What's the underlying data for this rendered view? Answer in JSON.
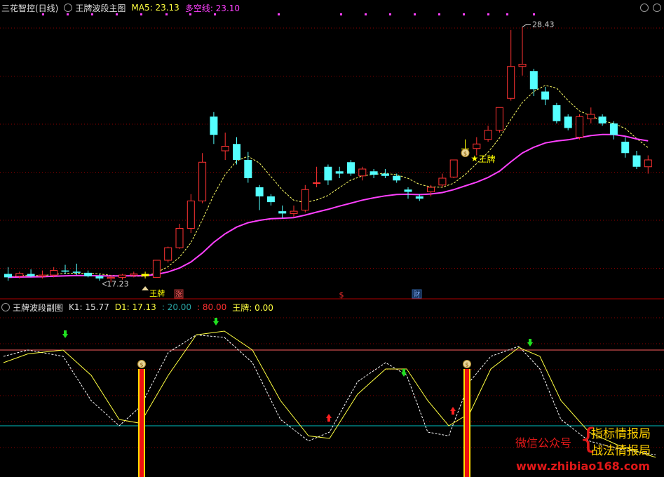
{
  "main_header": {
    "app_title": "三花智控(日线)",
    "indicator_name": "王牌波段主图",
    "ma5_label": "MA5: 23.13",
    "duokong_label": "多空线: 23.10"
  },
  "sub_header": {
    "indicator_name": "王牌波段副图",
    "k1_label": "K1: 15.77",
    "d1_label": "D1: 17.13",
    "level_low": ": 20.00",
    "level_high": ": 80.00",
    "wangpai_label": "王牌: 0.00"
  },
  "annotations": {
    "high_price": "28.43",
    "low_price": "17.23",
    "wangpai_text": "王牌",
    "wangpai_text_partial": "王牌",
    "zhang_badge": "涨",
    "cai_badge": "财",
    "dollar_mark": "$"
  },
  "watermark": {
    "wechat": "微信公众号",
    "line1": "指标情报局",
    "line2": "战法情报局",
    "url": "www.zhibiao168.com"
  },
  "colors": {
    "up_candle": "#ff3232",
    "down_candle": "#54ffff",
    "signal_bar": "#ffff00",
    "ma_line": "#ffff66",
    "duokong_line": "#ff40ff",
    "k_line": "#ffff40",
    "d_line": "#ffffff",
    "grid": "#8b0000",
    "level_80": "#ff6060",
    "level_20": "#00c0c0"
  },
  "chart_data": [
    {
      "type": "candlestick",
      "title": "王牌波段主图",
      "series": [
        {
          "name": "K线",
          "ohlc": [
            [
              17.6,
              17.9,
              17.3,
              17.45
            ],
            [
              17.5,
              17.7,
              17.4,
              17.62
            ],
            [
              17.6,
              17.8,
              17.45,
              17.5
            ],
            [
              17.5,
              17.75,
              17.4,
              17.55
            ],
            [
              17.55,
              17.9,
              17.45,
              17.75
            ],
            [
              17.75,
              18.0,
              17.6,
              17.7
            ],
            [
              17.7,
              18.05,
              17.55,
              17.65
            ],
            [
              17.65,
              17.75,
              17.45,
              17.5
            ],
            [
              17.5,
              17.6,
              17.3,
              17.4
            ],
            [
              17.4,
              17.55,
              17.23,
              17.45
            ],
            [
              17.45,
              17.6,
              17.35,
              17.55
            ],
            [
              17.55,
              17.7,
              17.45,
              17.6
            ],
            [
              17.6,
              17.7,
              17.4,
              17.5
            ],
            [
              17.45,
              18.2,
              17.45,
              18.2
            ],
            [
              18.2,
              18.8,
              18.1,
              18.75
            ],
            [
              18.75,
              19.8,
              18.7,
              19.6
            ],
            [
              19.6,
              21.1,
              19.4,
              20.8
            ],
            [
              20.8,
              22.9,
              20.7,
              22.5
            ],
            [
              24.5,
              24.7,
              23.3,
              23.7
            ],
            [
              23.0,
              23.8,
              22.6,
              23.2
            ],
            [
              23.3,
              23.6,
              22.4,
              22.6
            ],
            [
              22.6,
              22.95,
              21.6,
              21.8
            ],
            [
              21.4,
              21.5,
              20.4,
              21.0
            ],
            [
              21.0,
              21.1,
              20.6,
              20.75
            ],
            [
              20.35,
              20.6,
              20.05,
              20.25
            ],
            [
              20.25,
              20.6,
              20.1,
              20.35
            ],
            [
              20.4,
              21.5,
              20.3,
              21.3
            ],
            [
              21.6,
              22.3,
              21.4,
              21.6
            ],
            [
              22.3,
              22.4,
              21.5,
              21.7
            ],
            [
              22.1,
              22.3,
              21.8,
              22.0
            ],
            [
              22.5,
              22.6,
              21.9,
              22.0
            ],
            [
              21.9,
              22.3,
              21.7,
              22.2
            ],
            [
              22.1,
              22.2,
              21.8,
              21.95
            ],
            [
              22.0,
              22.2,
              21.8,
              21.9
            ],
            [
              21.9,
              22.0,
              21.6,
              21.7
            ],
            [
              21.3,
              21.4,
              20.9,
              21.2
            ],
            [
              21.0,
              21.1,
              20.8,
              20.9
            ],
            [
              21.2,
              21.5,
              21.0,
              21.4
            ],
            [
              21.5,
              22.0,
              21.4,
              21.8
            ],
            [
              21.85,
              22.6,
              21.8,
              22.6
            ],
            [
              23.1,
              23.5,
              22.9,
              23.1
            ],
            [
              23.1,
              23.6,
              22.8,
              23.3
            ],
            [
              23.5,
              24.1,
              23.4,
              23.9
            ],
            [
              23.9,
              24.5,
              23.8,
              24.9
            ],
            [
              25.3,
              28.3,
              25.2,
              26.7
            ],
            [
              26.7,
              28.43,
              26.3,
              26.8
            ],
            [
              26.5,
              26.6,
              25.4,
              25.7
            ],
            [
              25.6,
              25.8,
              25.0,
              25.25
            ],
            [
              25.0,
              25.1,
              24.2,
              24.3
            ],
            [
              24.5,
              24.6,
              23.9,
              24.0
            ],
            [
              23.6,
              24.6,
              23.5,
              24.5
            ],
            [
              24.4,
              24.9,
              24.2,
              24.6
            ],
            [
              24.5,
              24.6,
              24.1,
              24.2
            ],
            [
              24.2,
              24.3,
              23.5,
              23.7
            ],
            [
              23.4,
              23.6,
              22.7,
              22.9
            ],
            [
              22.8,
              23.0,
              22.2,
              22.3
            ],
            [
              22.3,
              22.8,
              22.0,
              22.6
            ]
          ]
        },
        {
          "name": "MA5",
          "value": 23.13
        },
        {
          "name": "多空线",
          "value": 23.1
        }
      ],
      "annotations": [
        "28.43",
        "17.23"
      ]
    },
    {
      "type": "line",
      "title": "王牌波段副图",
      "series": [
        {
          "name": "K1",
          "value": 15.77
        },
        {
          "name": "D1",
          "value": 17.13
        },
        {
          "name": "20.00",
          "value": 20.0
        },
        {
          "name": "80.00",
          "value": 80.0
        },
        {
          "name": "王牌",
          "value": 0.0
        }
      ]
    }
  ]
}
